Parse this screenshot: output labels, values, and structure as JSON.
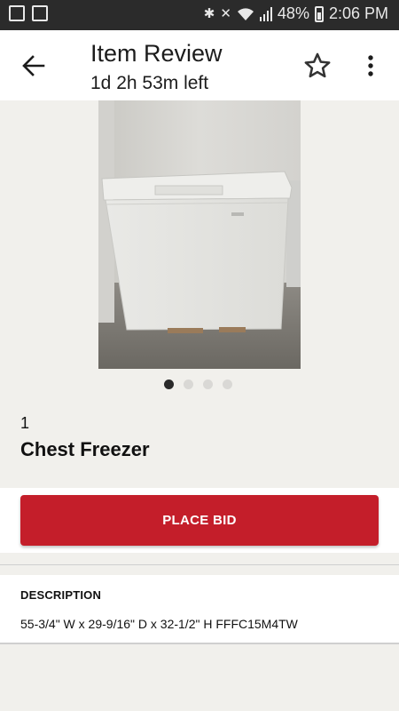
{
  "status_bar": {
    "battery": "48%",
    "time": "2:06 PM",
    "icons": [
      "image-icon",
      "file-sync-icon",
      "bluetooth-icon",
      "mute-icon",
      "wifi-icon",
      "signal-icon",
      "battery-icon"
    ]
  },
  "header": {
    "title": "Item Review",
    "time_left": "1d 2h 53m left"
  },
  "gallery": {
    "image_count": 4,
    "active_index": 0
  },
  "item": {
    "lot_number": "1",
    "name": "Chest Freezer"
  },
  "bid": {
    "button_label": "PLACE BID",
    "button_color": "#c41e2a"
  },
  "description": {
    "heading": "DESCRIPTION",
    "text": "55-3/4\" W x 29-9/16\" D x 32-1/2\" H FFFC15M4TW"
  }
}
